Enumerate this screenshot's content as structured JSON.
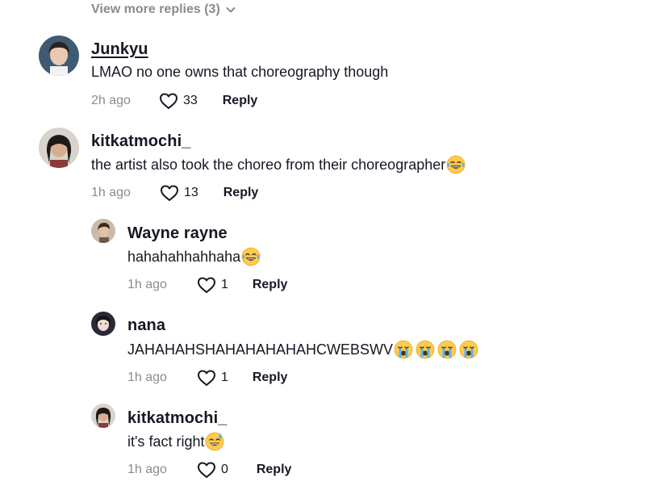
{
  "view_more": {
    "label": "View more replies (3)",
    "icon": "chevron-down-icon"
  },
  "comments": [
    {
      "username": "Junkyu",
      "text": "LMAO no one owns that choreography though",
      "time": "2h ago",
      "likes": "33",
      "reply": "Reply",
      "emoji": ""
    },
    {
      "username": "kitkatmochi_",
      "text": "the artist also took the choreo from their choreographer",
      "time": "1h ago",
      "likes": "13",
      "reply": "Reply",
      "emoji": "laughing-tears-emoji"
    },
    {
      "username": "Wayne rayne",
      "text": "hahahahhahhaha",
      "time": "1h ago",
      "likes": "1",
      "reply": "Reply",
      "emoji": "laughing-tears-emoji"
    },
    {
      "username": "nana",
      "text": "JAHAHAHSHAHAHAHAHAHCWEBSWV",
      "time": "1h ago",
      "likes": "1",
      "reply": "Reply",
      "emoji": "loudly-crying-emoji x4"
    },
    {
      "username": "kitkatmochi_",
      "text": "it's fact right",
      "time": "1h ago",
      "likes": "0",
      "reply": "Reply",
      "emoji": "sweat-smile-emoji"
    }
  ],
  "colors": {
    "text": "#161823",
    "muted": "#8a8b91",
    "emoji_face": "#ffcb4c"
  }
}
